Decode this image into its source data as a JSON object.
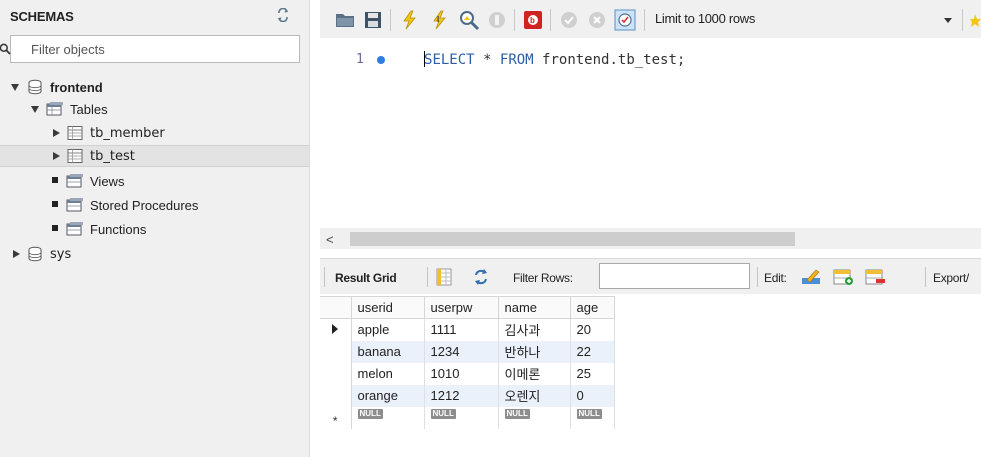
{
  "schemas": {
    "title": "SCHEMAS",
    "filter_placeholder": "Filter objects",
    "tree": {
      "frontend": "frontend",
      "tables": "Tables",
      "table_1": "tb_member",
      "table_2": "tb_test",
      "views": "Views",
      "stored_procedures": "Stored Procedures",
      "functions": "Functions",
      "sys": "sys"
    }
  },
  "toolbar": {
    "limit_label": "Limit to 1000 rows"
  },
  "editor": {
    "line_number": "1",
    "code_first_char": "S",
    "code_kw1_rest": "ELECT",
    "code_star": " * ",
    "code_kw2": "FROM",
    "code_rest": " frontend.tb_test;"
  },
  "scrollbar": {
    "left_arrow": "<"
  },
  "result_bar": {
    "result_grid": "Result Grid",
    "filter_rows": "Filter Rows:",
    "edit": "Edit:",
    "export": "Export/"
  },
  "grid": {
    "columns": [
      "userid",
      "userpw",
      "name",
      "age"
    ],
    "rows": [
      [
        "apple",
        "1111",
        "김사과",
        "20"
      ],
      [
        "banana",
        "1234",
        "반하나",
        "22"
      ],
      [
        "melon",
        "1010",
        "이메론",
        "25"
      ],
      [
        "orange",
        "1212",
        "오렌지",
        "0"
      ]
    ],
    "null_label": "NULL",
    "new_row_marker": "*"
  },
  "colors": {
    "panel_bg": "#f0f0f0",
    "keyword": "#2b5ea7",
    "row_alt": "#eaf1fb",
    "null_badge": "#8d8d8d"
  }
}
